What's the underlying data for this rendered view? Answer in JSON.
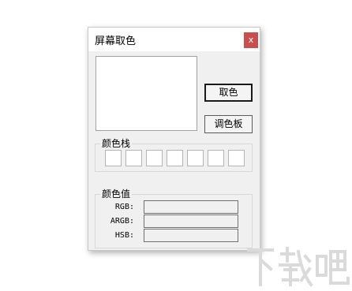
{
  "window": {
    "title": "屏幕取色",
    "close_label": "x"
  },
  "buttons": {
    "pick_label": "取色",
    "palette_label": "调色板"
  },
  "color_stack": {
    "label": "颜色栈",
    "swatches": [
      "#ffffff",
      "#ffffff",
      "#ffffff",
      "#ffffff",
      "#ffffff",
      "#ffffff",
      "#ffffff"
    ]
  },
  "color_value": {
    "label": "颜色值",
    "fields": [
      {
        "label": "RGB:",
        "value": ""
      },
      {
        "label": "ARGB:",
        "value": ""
      },
      {
        "label": "HSB:",
        "value": ""
      }
    ]
  },
  "watermark": {
    "text": "下载吧",
    "color": "#d8d8d8"
  },
  "colors": {
    "close_button": "#c94f4f",
    "window_background": "#f0f0f0",
    "preview_background": "#ffffff"
  }
}
